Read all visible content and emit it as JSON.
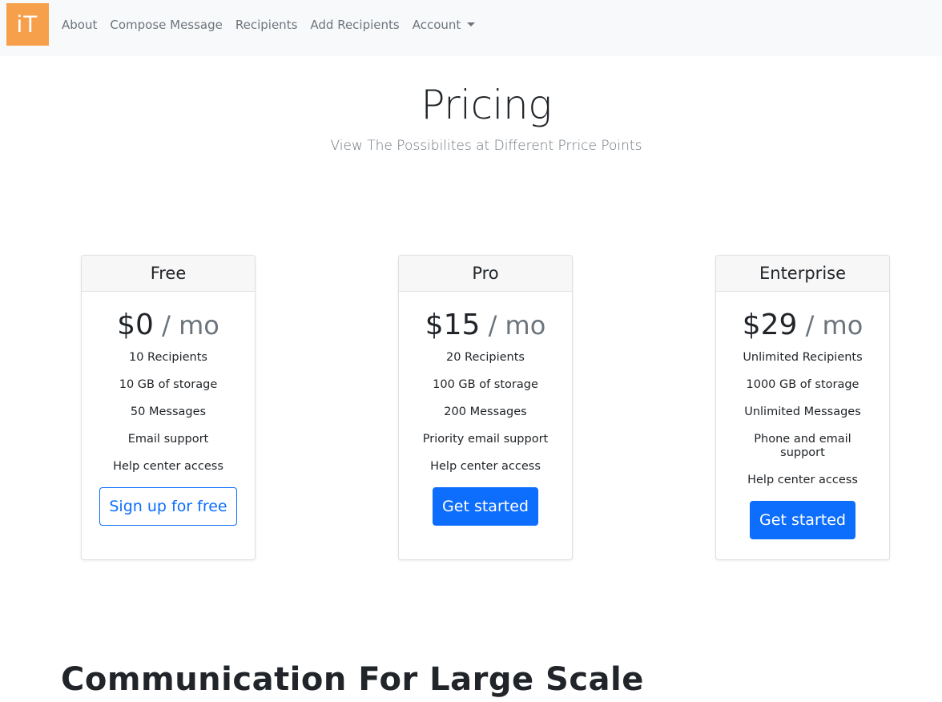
{
  "navbar": {
    "logo_text": "iT",
    "logo_color": "#f7a04b",
    "links": [
      {
        "label": "About"
      },
      {
        "label": "Compose Message"
      },
      {
        "label": "Recipients"
      },
      {
        "label": "Add Recipients"
      },
      {
        "label": "Account",
        "dropdown": true
      }
    ]
  },
  "hero": {
    "title": "Pricing",
    "subtitle": "View The Possibilites at Different Prrice Points"
  },
  "plans": [
    {
      "name": "Free",
      "price": "$0",
      "period": " / mo",
      "features": [
        "10 Recipients",
        "10 GB of storage",
        "50 Messages",
        "Email support",
        "Help center access"
      ],
      "button_label": "Sign up for free",
      "button_style": "outline"
    },
    {
      "name": "Pro",
      "price": "$15",
      "period": " / mo",
      "features": [
        "20 Recipients",
        "100 GB of storage",
        "200 Messages",
        "Priority email support",
        "Help center access"
      ],
      "button_label": "Get started",
      "button_style": "primary"
    },
    {
      "name": "Enterprise",
      "price": "$29",
      "period": " / mo",
      "features": [
        "Unlimited Recipients",
        "1000 GB of storage",
        "Unlimited Messages",
        "Phone and email support",
        "Help center access"
      ],
      "button_label": "Get started",
      "button_style": "primary"
    }
  ],
  "section": {
    "title": "Communication For Large Scale"
  },
  "colors": {
    "accent": "#0d6efd",
    "navbar_bg": "#f8f9fa",
    "muted": "#6c757d"
  }
}
